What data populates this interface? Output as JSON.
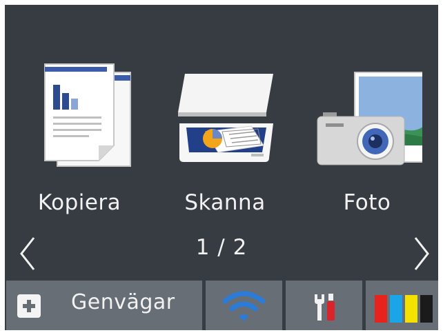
{
  "tiles": [
    {
      "label": "Kopiera",
      "icon": "copy-documents-icon"
    },
    {
      "label": "Skanna",
      "icon": "scanner-icon"
    },
    {
      "label": "Foto",
      "icon": "camera-photo-icon"
    }
  ],
  "pager": {
    "text": "1 / 2",
    "current": 1,
    "total": 2
  },
  "bottom_bar": {
    "shortcuts_label": "Genvägar",
    "shortcuts_icon": "plus-icon",
    "wifi_icon": "wifi-icon",
    "tools_icon": "tools-icon",
    "ink_icon": "ink-cartridges-icon"
  },
  "colors": {
    "screen_background": "#373c43",
    "button_background": "#686e76",
    "text": "#f2f2f2",
    "wifi": "#2b7bd8",
    "ink": [
      "#e8231d",
      "#1aa5e8",
      "#f5e100",
      "#1b1b1b"
    ]
  }
}
